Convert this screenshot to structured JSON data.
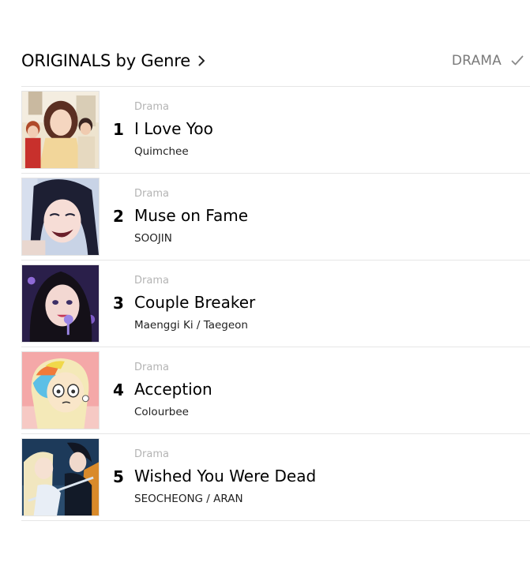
{
  "section": {
    "title": "ORIGINALS by Genre",
    "selected_genre": "DRAMA"
  },
  "items": [
    {
      "rank": "1",
      "genre": "Drama",
      "title": "I Love Yoo",
      "author": "Quimchee"
    },
    {
      "rank": "2",
      "genre": "Drama",
      "title": "Muse on Fame",
      "author": "SOOJIN"
    },
    {
      "rank": "3",
      "genre": "Drama",
      "title": "Couple Breaker",
      "author": "Maenggi Ki / Taegeon"
    },
    {
      "rank": "4",
      "genre": "Drama",
      "title": "Acception",
      "author": "Colourbee"
    },
    {
      "rank": "5",
      "genre": "Drama",
      "title": "Wished You Were Dead",
      "author": "SEOCHEONG / ARAN"
    }
  ],
  "colors": {
    "genre_label": "#7a7a7a",
    "genre_tag": "#b4b4b4",
    "divider": "#e6e6e6"
  }
}
